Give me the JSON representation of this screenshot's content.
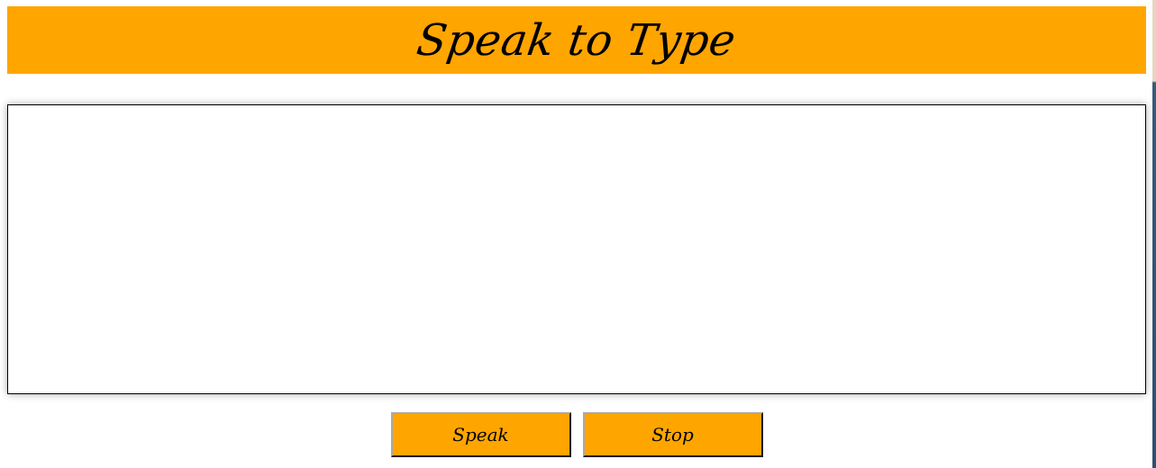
{
  "app": {
    "title": "Speak to Type"
  },
  "editor": {
    "value": "",
    "placeholder": ""
  },
  "controls": {
    "speak_label": "Speak",
    "stop_label": "Stop"
  },
  "colors": {
    "accent": "#FFA500",
    "text": "#000000",
    "background": "#FFFFFF"
  }
}
